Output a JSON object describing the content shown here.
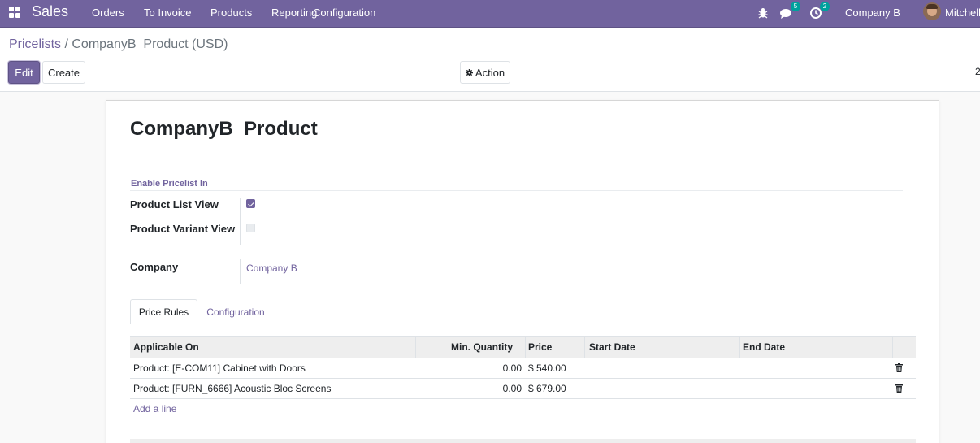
{
  "navbar": {
    "app_name": "Sales",
    "menu": [
      "Orders",
      "To Invoice",
      "Products",
      "Reporting",
      "Configuration"
    ],
    "messages_count": "5",
    "activities_count": "2",
    "company": "Company B",
    "user_name": "Mitchell A",
    "icons": {
      "apps": "apps-grid-icon",
      "debug": "bug-icon",
      "messages": "chat-icon",
      "activities": "clock-icon"
    }
  },
  "control_panel": {
    "breadcrumb_parent": "Pricelists",
    "breadcrumb_separator": "/",
    "breadcrumb_current": "CompanyB_Product (USD)",
    "edit_label": "Edit",
    "create_label": "Create",
    "action_label": "Action",
    "pager": "2"
  },
  "form": {
    "title": "CompanyB_Product",
    "group_title": "Enable Pricelist In",
    "product_list_view_label": "Product List View",
    "product_list_view_checked": true,
    "product_variant_view_label": "Product Variant View",
    "product_variant_view_checked": false,
    "company_label": "Company",
    "company_value": "Company B"
  },
  "tabs": [
    {
      "label": "Price Rules",
      "active": true
    },
    {
      "label": "Configuration",
      "active": false
    }
  ],
  "rules_table": {
    "columns": [
      "Applicable On",
      "Min. Quantity",
      "Price",
      "Start Date",
      "End Date"
    ],
    "rows": [
      {
        "applicable_on": "Product: [E-COM11] Cabinet with Doors",
        "min_quantity": "0.00",
        "price": "$ 540.00",
        "start_date": "",
        "end_date": ""
      },
      {
        "applicable_on": "Product: [FURN_6666] Acoustic Bloc Screens",
        "min_quantity": "0.00",
        "price": "$ 679.00",
        "start_date": "",
        "end_date": ""
      }
    ],
    "add_line_label": "Add a line"
  },
  "colors": {
    "brand": "#71639e",
    "badge": "#00a09d"
  }
}
